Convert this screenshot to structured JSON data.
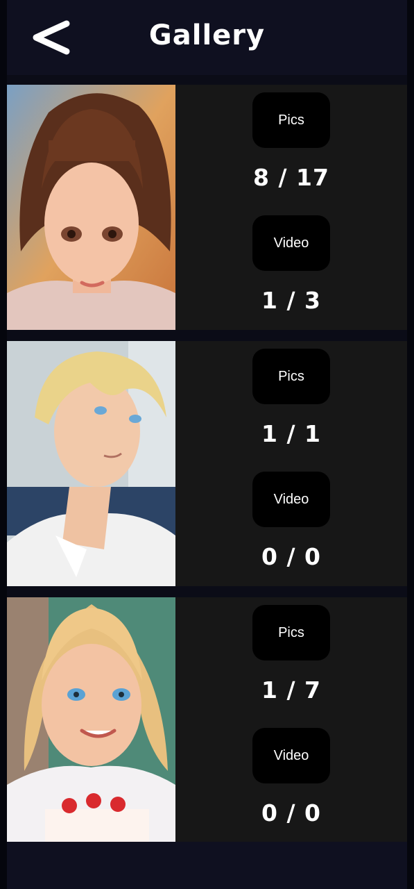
{
  "header": {
    "title": "Gallery",
    "back_icon": "chevron-left-icon"
  },
  "colors": {
    "background": "#0b0c17",
    "header": "#0f1020",
    "card": "#171717",
    "pill": "#000000",
    "text": "#ffffff"
  },
  "characters": [
    {
      "pics_label": "Pics",
      "pics_count": "8 / 17",
      "video_label": "Video",
      "video_count": "1 / 3"
    },
    {
      "pics_label": "Pics",
      "pics_count": "1 / 1",
      "video_label": "Video",
      "video_count": "0 / 0"
    },
    {
      "pics_label": "Pics",
      "pics_count": "1 / 7",
      "video_label": "Video",
      "video_count": "0 / 0"
    }
  ]
}
